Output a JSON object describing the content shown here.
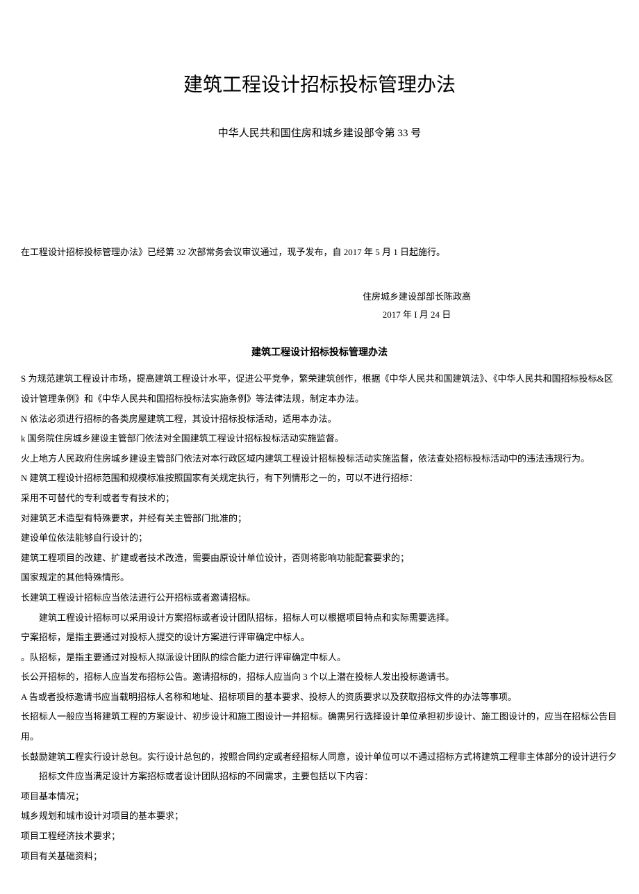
{
  "mainTitle": "建筑工程设计招标投标管理办法",
  "subTitle": "中华人民共和国住房和城乡建设部令第 33 号",
  "introParagraph": "在工程设计招标投标管理办法》已经第 32 次部常务会议审议通过，现予发布，自 2017 年 5 月 1 日起施行。",
  "signature": {
    "line1": "住房城乡建设部部长陈政高",
    "line2": "2017 年 I 月 24 日"
  },
  "bodyTitle": "建筑工程设计招标投标管理办法",
  "paragraphs": [
    "S 为规范建筑工程设计市场，提高建筑工程设计水平，促进公平竞争，繁荣建筑创作，根据《中华人民共和国建筑法》、《中华人民共和国招标投标&区设计管理条例》和《中华人民共和国招标投标法实施条例》等法律法规，制定本办法。",
    "N 依法必须进行招标的各类房屋建筑工程，其设计招标投标活动，适用本办法。",
    "k 国务院住房城乡建设主管部门依法对全国建筑工程设计招标投标活动实施监督。",
    "火上地方人民政府住房城乡建设主管部门依法对本行政区域内建筑工程设计招标投标活动实施监督，依法查处招标投标活动中的违法违规行为。",
    "N 建筑工程设计招标范围和规模标准按照国家有关规定执行，有下列情形之一的，可以不进行招标：",
    "采用不可替代的专利或者专有技术的；",
    "对建筑艺术造型有特殊要求，并经有关主管部门批准的；",
    "建设单位依法能够自行设计的；",
    "建筑工程项目的改建、扩建或者技术改造，需要由原设计单位设计，否则将影响功能配套要求的；",
    "国家规定的其他特殊情形。",
    "长建筑工程设计招标应当依法进行公开招标或者邀请招标。",
    "建筑工程设计招标可以采用设计方案招标或者设计团队招标，招标人可以根据项目特点和实际需要选择。",
    "宁案招标，是指主要通过对投标人提交的设计方案进行评审确定中标人。",
    "。队招标，是指主要通过对投标人拟派设计团队的综合能力进行评审确定中标人。",
    "长公开招标的，招标人应当发布招标公告。邀请招标的，招标人应当向 3 个以上潜在投标人发出投标邀请书。",
    "A 告或者投标邀请书应当载明招标人名称和地址、招标项目的基本要求、投标人的资质要求以及获取招标文件的办法等事项。",
    "长招标人一般应当将建筑工程的方案设计、初步设计和施工图设计一并招标。确需另行选择设计单位承担初步设计、施工图设计的，应当在招标公告目用。",
    "长鼓励建筑工程实行设计总包。实行设计总包的，按照合同约定或者经招标人同意，设计单位可以不通过招标方式将建筑工程非主体部分的设计进行夕",
    "招标文件应当满足设计方案招标或者设计团队招标的不同需求，主要包括以下内容：",
    "项目基本情况；",
    "城乡规划和城市设计对项目的基本要求；",
    "项目工程经济技术要求；",
    "项目有关基础资料；"
  ],
  "indentedIndices": [
    11,
    18
  ]
}
